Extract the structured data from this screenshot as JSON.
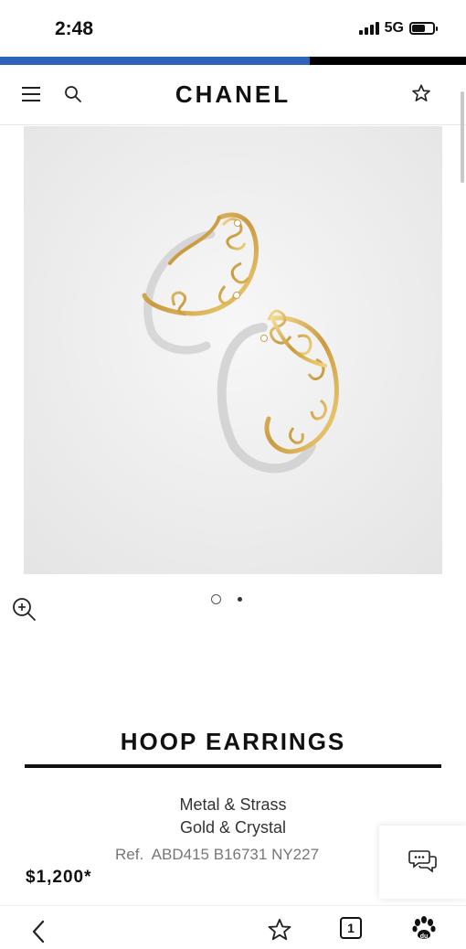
{
  "status_bar": {
    "time": "2:48",
    "network": "5G"
  },
  "loading": {
    "progress": 0.665,
    "color": "#2e63b8"
  },
  "header": {
    "brand": "CHANEL",
    "menu_icon": "hamburger-menu-icon",
    "search_icon": "search-icon",
    "wishlist_icon": "star-icon"
  },
  "gallery": {
    "image_count": 2,
    "active_index": 1,
    "zoom_icon": "zoom-in-icon"
  },
  "product": {
    "name": "HOOP EARRINGS",
    "material_line1": "Metal & Strass",
    "material_line2": "Gold & Crystal",
    "ref": "Ref.  ABD415 B16731 NY227",
    "price": "$1,200*"
  },
  "chat": {
    "icon": "chat-bubbles-icon"
  },
  "toolbar": {
    "back_icon": "back-chevron-icon",
    "favorite_icon": "star-outline-icon",
    "tabs_count": "1",
    "app_icon": "paw-icon"
  }
}
